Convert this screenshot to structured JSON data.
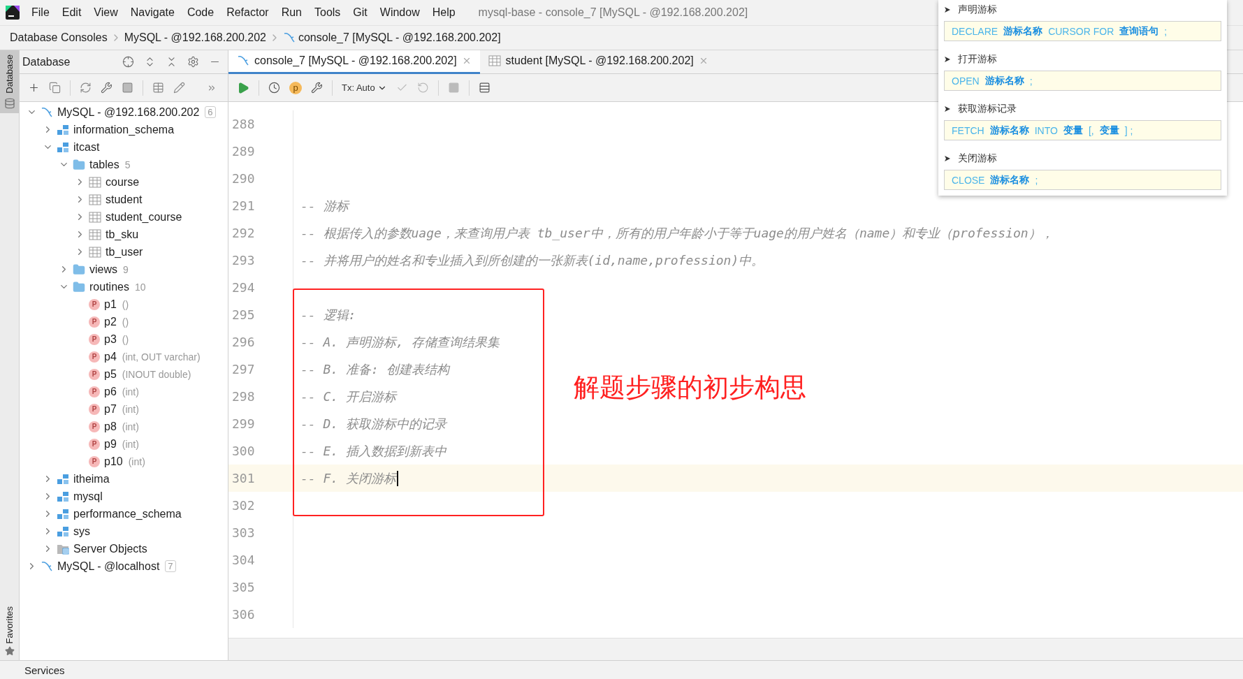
{
  "menu_bar": {
    "items": [
      "File",
      "Edit",
      "View",
      "Navigate",
      "Code",
      "Refactor",
      "Run",
      "Tools",
      "Git",
      "Window",
      "Help"
    ],
    "title": "mysql-base - console_7 [MySQL - @192.168.200.202]"
  },
  "breadcrumbs": [
    {
      "label": "Database Consoles",
      "kind": "plain"
    },
    {
      "label": "MySQL - @192.168.200.202",
      "kind": "plain"
    },
    {
      "label": "console_7 [MySQL - @192.168.200.202]",
      "kind": "console"
    }
  ],
  "side_strip": {
    "top_label": "Database",
    "bottom_label": "Favorites"
  },
  "database_panel": {
    "title": "Database",
    "tree": [
      {
        "label": "MySQL - @192.168.200.202",
        "kind": "connection",
        "badge": "6",
        "expanded": true,
        "children": [
          {
            "label": "information_schema",
            "kind": "schema",
            "expanded": false
          },
          {
            "label": "itcast",
            "kind": "schema",
            "expanded": true,
            "children": [
              {
                "label": "tables",
                "kind": "folder",
                "count": "5",
                "expanded": true,
                "children": [
                  {
                    "label": "course",
                    "kind": "table",
                    "expanded": false
                  },
                  {
                    "label": "student",
                    "kind": "table",
                    "expanded": false
                  },
                  {
                    "label": "student_course",
                    "kind": "table",
                    "expanded": false
                  },
                  {
                    "label": "tb_sku",
                    "kind": "table",
                    "expanded": false
                  },
                  {
                    "label": "tb_user",
                    "kind": "table",
                    "expanded": false
                  }
                ]
              },
              {
                "label": "views",
                "kind": "folder",
                "count": "9",
                "expanded": false
              },
              {
                "label": "routines",
                "kind": "folder",
                "count": "10",
                "expanded": true,
                "children": [
                  {
                    "label": "p1",
                    "kind": "routine",
                    "icon_text": "P",
                    "signature": "()"
                  },
                  {
                    "label": "p2",
                    "kind": "routine",
                    "icon_text": "P",
                    "signature": "()"
                  },
                  {
                    "label": "p3",
                    "kind": "routine",
                    "icon_text": "P",
                    "signature": "()"
                  },
                  {
                    "label": "p4",
                    "kind": "routine",
                    "icon_text": "P",
                    "signature": "(int, OUT varchar)"
                  },
                  {
                    "label": "p5",
                    "kind": "routine",
                    "icon_text": "P",
                    "signature": "(INOUT double)"
                  },
                  {
                    "label": "p6",
                    "kind": "routine",
                    "icon_text": "P",
                    "signature": "(int)"
                  },
                  {
                    "label": "p7",
                    "kind": "routine",
                    "icon_text": "P",
                    "signature": "(int)"
                  },
                  {
                    "label": "p8",
                    "kind": "routine",
                    "icon_text": "P",
                    "signature": "(int)"
                  },
                  {
                    "label": "p9",
                    "kind": "routine",
                    "icon_text": "P",
                    "signature": "(int)"
                  },
                  {
                    "label": "p10",
                    "kind": "routine",
                    "icon_text": "P",
                    "signature": "(int)"
                  }
                ]
              }
            ]
          },
          {
            "label": "itheima",
            "kind": "schema",
            "expanded": false
          },
          {
            "label": "mysql",
            "kind": "schema",
            "expanded": false
          },
          {
            "label": "performance_schema",
            "kind": "schema",
            "expanded": false
          },
          {
            "label": "sys",
            "kind": "schema",
            "expanded": false
          },
          {
            "label": "Server Objects",
            "kind": "server",
            "expanded": false
          }
        ]
      },
      {
        "label": "MySQL - @localhost",
        "kind": "connection",
        "badge": "7",
        "expanded": false
      }
    ]
  },
  "editor_tabs": [
    {
      "label": "console_7 [MySQL - @192.168.200.202]",
      "kind": "console",
      "selected": true
    },
    {
      "label": "student [MySQL - @192.168.200.202]",
      "kind": "table",
      "selected": false
    }
  ],
  "toolbar": {
    "profile_letter": "p",
    "tx_mode": "Tx: Auto"
  },
  "editor": {
    "lines": [
      {
        "number": "288",
        "current": false
      },
      {
        "number": "289",
        "current": false
      },
      {
        "number": "290",
        "current": false
      },
      {
        "number": "291",
        "text": "-- 游标",
        "current": false
      },
      {
        "number": "292",
        "text": "-- 根据传入的参数uage，来查询用户表 tb_user中，所有的用户年龄小于等于uage的用户姓名（name）和专业（profession），",
        "current": false
      },
      {
        "number": "293",
        "text": "-- 并将用户的姓名和专业插入到所创建的一张新表(id,name,profession)中。",
        "current": false
      },
      {
        "number": "294",
        "current": false
      },
      {
        "number": "295",
        "text": "-- 逻辑:",
        "current": false
      },
      {
        "number": "296",
        "text": "-- A. 声明游标, 存储查询结果集",
        "current": false
      },
      {
        "number": "297",
        "text": "-- B. 准备: 创建表结构",
        "current": false
      },
      {
        "number": "298",
        "text": "-- C. 开启游标",
        "current": false
      },
      {
        "number": "299",
        "text": "-- D. 获取游标中的记录",
        "current": false
      },
      {
        "number": "300",
        "text": "-- E. 插入数据到新表中",
        "current": false
      },
      {
        "number": "301",
        "text": "-- F. 关闭游标",
        "current": true
      },
      {
        "number": "302",
        "current": false
      },
      {
        "number": "303",
        "current": false
      },
      {
        "number": "304",
        "current": false
      },
      {
        "number": "305",
        "current": false
      },
      {
        "number": "306",
        "current": false
      }
    ],
    "annotation": {
      "label": "解题步骤的初步构思"
    }
  },
  "popup": {
    "sections": [
      {
        "heading": "声明游标",
        "tokens": [
          {
            "text": "DECLARE",
            "kind": "keyword"
          },
          {
            "text": "游标名称",
            "kind": "name"
          },
          {
            "text": "CURSOR FOR",
            "kind": "keyword"
          },
          {
            "text": "查询语句",
            "kind": "name"
          },
          {
            "text": ";",
            "kind": "keyword"
          }
        ]
      },
      {
        "heading": "打开游标",
        "tokens": [
          {
            "text": "OPEN",
            "kind": "keyword"
          },
          {
            "text": "游标名称",
            "kind": "name"
          },
          {
            "text": ";",
            "kind": "keyword"
          }
        ]
      },
      {
        "heading": "获取游标记录",
        "tokens": [
          {
            "text": "FETCH",
            "kind": "keyword"
          },
          {
            "text": "游标名称",
            "kind": "name"
          },
          {
            "text": "INTO",
            "kind": "keyword"
          },
          {
            "text": "变量",
            "kind": "name"
          },
          {
            "text": "[,",
            "kind": "keyword"
          },
          {
            "text": "变量",
            "kind": "name"
          },
          {
            "text": "] ;",
            "kind": "keyword"
          }
        ]
      },
      {
        "heading": "关闭游标",
        "tokens": [
          {
            "text": "CLOSE",
            "kind": "keyword"
          },
          {
            "text": "游标名称",
            "kind": "name"
          },
          {
            "text": ";",
            "kind": "keyword"
          }
        ]
      }
    ]
  },
  "status_bar": {
    "services": "Services"
  }
}
